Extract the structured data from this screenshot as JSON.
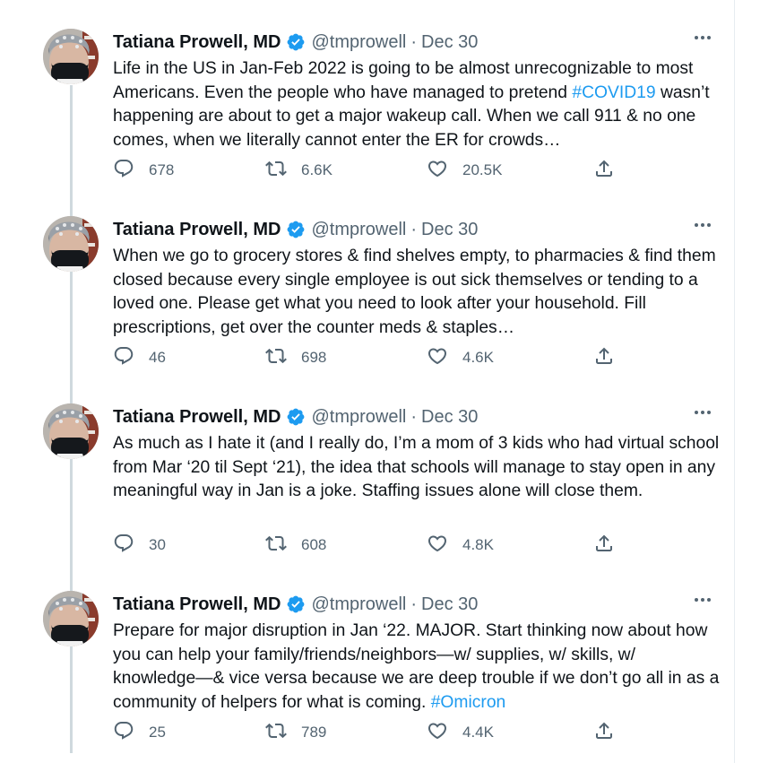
{
  "author": {
    "name": "Tatiana Prowell, MD",
    "handle": "@tmprowell",
    "separator": "·"
  },
  "colors": {
    "accent": "#1d9bf0",
    "secondary_text": "#536471",
    "primary_text": "#0f1419",
    "thread_line": "#cfd9de"
  },
  "icons": {
    "verified": "verified-badge-icon",
    "more": "more-dots-icon",
    "reply": "reply-icon",
    "retweet": "retweet-icon",
    "like": "heart-icon",
    "share": "share-icon"
  },
  "tweets": [
    {
      "date": "Dec 30",
      "text_before": "Life in the US in Jan-Feb 2022 is going to be almost unrecognizable to most Americans. Even the people who have managed to pretend ",
      "hashtag": "#COVID19",
      "text_after": " wasn’t happening are about to get a major wakeup call. When we call 911 & no one comes, when we literally cannot enter the ER for crowds…",
      "replies": "678",
      "retweets": "6.6K",
      "likes": "20.5K"
    },
    {
      "date": "Dec 30",
      "text_before": "When we go to grocery stores & find shelves empty, to pharmacies & find them closed because every single employee is out sick themselves or tending to a loved one. Please get what you need to look after your household. Fill prescriptions, get over the counter meds & staples…",
      "hashtag": "",
      "text_after": "",
      "replies": "46",
      "retweets": "698",
      "likes": "4.6K"
    },
    {
      "date": "Dec 30",
      "text_before": "As much as I hate it (and I really do, I’m a mom of 3 kids who had virtual school from Mar ‘20 til Sept ‘21), the idea that schools will manage to stay open in any meaningful way in Jan is a joke. Staffing issues alone will close them.",
      "hashtag": "",
      "text_after": "",
      "replies": "30",
      "retweets": "608",
      "likes": "4.8K"
    },
    {
      "date": "Dec 30",
      "text_before": "Prepare for major disruption in Jan ‘22. MAJOR. Start thinking now about how you can help your family/friends/neighbors—w/ supplies, w/ skills, w/ knowledge—& vice versa because we are deep trouble if we don’t go all in as a community of helpers for what is coming. ",
      "hashtag": "#Omicron",
      "text_after": "",
      "replies": "25",
      "retweets": "789",
      "likes": "4.4K"
    }
  ]
}
